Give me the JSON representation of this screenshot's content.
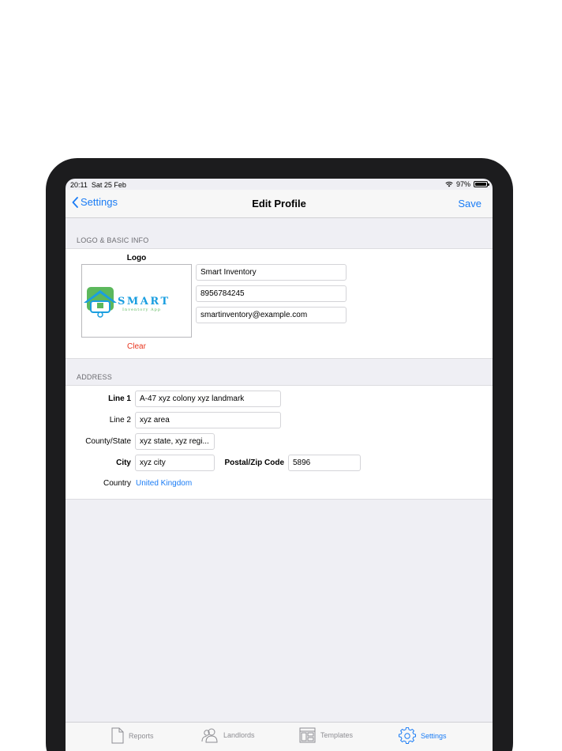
{
  "status_bar": {
    "time": "20:11",
    "date": "Sat 25 Feb",
    "battery": "97%"
  },
  "nav": {
    "back_label": "Settings",
    "title": "Edit Profile",
    "save_label": "Save"
  },
  "logo_section": {
    "header": "LOGO & BASIC INFO",
    "logo_label": "Logo",
    "logo_word": "SMART",
    "logo_sub": "Inventory App",
    "clear_label": "Clear",
    "name_value": "Smart Inventory",
    "phone_value": "8956784245",
    "email_value": "smartinventory@example.com"
  },
  "address_section": {
    "header": "ADDRESS",
    "line1_label": "Line 1",
    "line1_value": "A-47 xyz colony xyz landmark",
    "line2_label": "Line 2",
    "line2_value": "xyz area",
    "county_label": "County/State",
    "county_value": "xyz state, xyz regi...",
    "city_label": "City",
    "city_value": "xyz city",
    "postal_label": "Postal/Zip Code",
    "postal_value": "5896",
    "country_label": "Country",
    "country_value": "United Kingdom"
  },
  "tabs": [
    {
      "label": "Reports",
      "icon": "document-icon"
    },
    {
      "label": "Landlords",
      "icon": "people-icon"
    },
    {
      "label": "Templates",
      "icon": "template-icon"
    },
    {
      "label": "Settings",
      "icon": "gear-icon"
    }
  ],
  "colors": {
    "accent": "#1a7cf5",
    "destructive": "#e8361f",
    "logo_green": "#5cb85c",
    "logo_blue": "#1a9ee0"
  }
}
